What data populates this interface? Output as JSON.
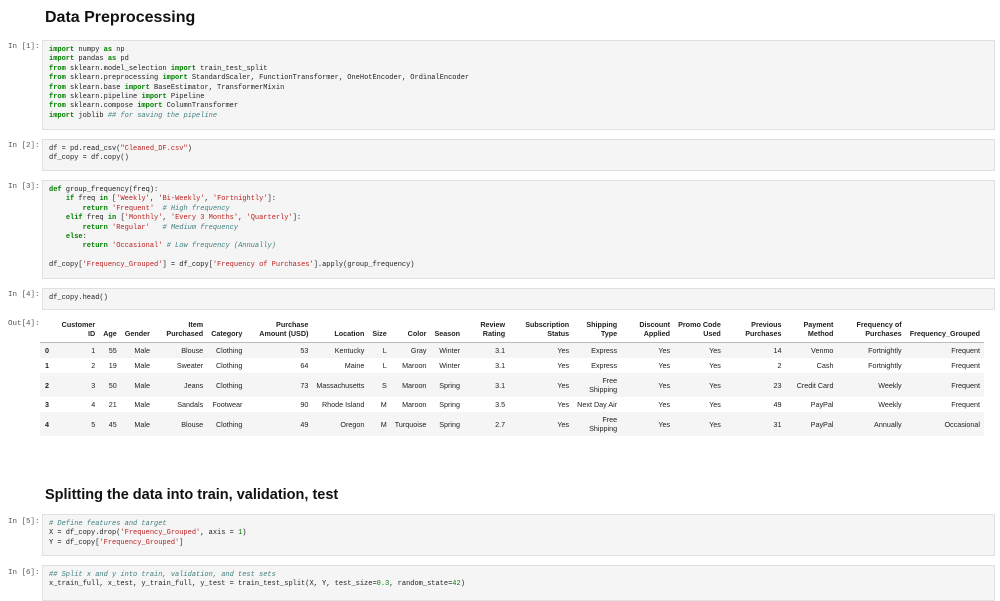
{
  "headings": {
    "preprocessing": "Data Preprocessing",
    "splitting": "Splitting the data into train, validation, test"
  },
  "cells": {
    "c1": {
      "prompt": "In [1]:",
      "lines": [
        [
          [
            "kw",
            "import"
          ],
          [
            "p",
            " numpy "
          ],
          [
            "kw",
            "as"
          ],
          [
            "p",
            " np"
          ]
        ],
        [
          [
            "kw",
            "import"
          ],
          [
            "p",
            " pandas "
          ],
          [
            "kw",
            "as"
          ],
          [
            "p",
            " pd"
          ]
        ],
        [
          [
            "kw",
            "from"
          ],
          [
            "p",
            " sklearn.model_selection "
          ],
          [
            "kw",
            "import"
          ],
          [
            "p",
            " train_test_split"
          ]
        ],
        [
          [
            "kw",
            "from"
          ],
          [
            "p",
            " sklearn.preprocessing "
          ],
          [
            "kw",
            "import"
          ],
          [
            "p",
            " StandardScaler, FunctionTransformer, OneHotEncoder, OrdinalEncoder"
          ]
        ],
        [
          [
            "kw",
            "from"
          ],
          [
            "p",
            " sklearn.base "
          ],
          [
            "kw",
            "import"
          ],
          [
            "p",
            " BaseEstimator, TransformerMixin"
          ]
        ],
        [
          [
            "kw",
            "from"
          ],
          [
            "p",
            " sklearn.pipeline "
          ],
          [
            "kw",
            "import"
          ],
          [
            "p",
            " Pipeline"
          ]
        ],
        [
          [
            "kw",
            "from"
          ],
          [
            "p",
            " sklearn.compose "
          ],
          [
            "kw",
            "import"
          ],
          [
            "p",
            " ColumnTransformer"
          ]
        ],
        [
          [
            "kw",
            "import"
          ],
          [
            "p",
            " joblib "
          ],
          [
            "cm",
            "## for saving the pipeline"
          ]
        ]
      ]
    },
    "c2": {
      "prompt": "In [2]:",
      "lines": [
        [
          [
            "p",
            "df = pd.read_csv("
          ],
          [
            "st",
            "\"Cleaned_DF.csv\""
          ],
          [
            "p",
            ")"
          ]
        ],
        [
          [
            "p",
            "df_copy = df.copy()"
          ]
        ]
      ]
    },
    "c3": {
      "prompt": "In [3]:",
      "lines": [
        [
          [
            "kw",
            "def"
          ],
          [
            "p",
            " group_frequency(freq):"
          ]
        ],
        [
          [
            "p",
            "    "
          ],
          [
            "kw",
            "if"
          ],
          [
            "p",
            " freq "
          ],
          [
            "kw",
            "in"
          ],
          [
            "p",
            " ["
          ],
          [
            "st",
            "'Weekly'"
          ],
          [
            "p",
            ", "
          ],
          [
            "st",
            "'Bi-Weekly'"
          ],
          [
            "p",
            ", "
          ],
          [
            "st",
            "'Fortnightly'"
          ],
          [
            "p",
            "]:"
          ]
        ],
        [
          [
            "p",
            "        "
          ],
          [
            "kw",
            "return"
          ],
          [
            "p",
            " "
          ],
          [
            "st",
            "'Frequent'"
          ],
          [
            "p",
            "  "
          ],
          [
            "cm",
            "# High frequency"
          ]
        ],
        [
          [
            "p",
            "    "
          ],
          [
            "kw",
            "elif"
          ],
          [
            "p",
            " freq "
          ],
          [
            "kw",
            "in"
          ],
          [
            "p",
            " ["
          ],
          [
            "st",
            "'Monthly'"
          ],
          [
            "p",
            ", "
          ],
          [
            "st",
            "'Every 3 Months'"
          ],
          [
            "p",
            ", "
          ],
          [
            "st",
            "'Quarterly'"
          ],
          [
            "p",
            "]:"
          ]
        ],
        [
          [
            "p",
            "        "
          ],
          [
            "kw",
            "return"
          ],
          [
            "p",
            " "
          ],
          [
            "st",
            "'Regular'"
          ],
          [
            "p",
            "   "
          ],
          [
            "cm",
            "# Medium frequency"
          ]
        ],
        [
          [
            "p",
            "    "
          ],
          [
            "kw",
            "else"
          ],
          [
            "p",
            ":"
          ]
        ],
        [
          [
            "p",
            "        "
          ],
          [
            "kw",
            "return"
          ],
          [
            "p",
            " "
          ],
          [
            "st",
            "'Occasional'"
          ],
          [
            "p",
            " "
          ],
          [
            "cm",
            "# Low frequency (Annually)"
          ]
        ],
        [
          [
            "p",
            " "
          ]
        ],
        [
          [
            "p",
            "df_copy["
          ],
          [
            "st",
            "'Frequency_Grouped'"
          ],
          [
            "p",
            "] = df_copy["
          ],
          [
            "st",
            "'Frequency of Purchases'"
          ],
          [
            "p",
            "].apply(group_frequency)"
          ]
        ]
      ]
    },
    "c4": {
      "prompt": "In [4]:",
      "lines": [
        [
          [
            "p",
            "df_copy.head()"
          ]
        ]
      ]
    },
    "c5": {
      "prompt": "In [5]:",
      "lines": [
        [
          [
            "cm",
            "# Define features and target"
          ]
        ],
        [
          [
            "p",
            "X = df_copy.drop("
          ],
          [
            "st",
            "'Frequency_Grouped'"
          ],
          [
            "p",
            ", axis = "
          ],
          [
            "nm",
            "1"
          ],
          [
            "p",
            ")"
          ]
        ],
        [
          [
            "p",
            "Y = df_copy["
          ],
          [
            "st",
            "'Frequency_Grouped'"
          ],
          [
            "p",
            "]"
          ]
        ]
      ]
    },
    "c6": {
      "prompt": "In [6]:",
      "lines": [
        [
          [
            "cm",
            "## Split x and y into train, validation, and test sets"
          ]
        ],
        [
          [
            "p",
            "x_train_full, x_test, y_train_full, y_test = train_test_split(X, Y, test_size="
          ],
          [
            "nm",
            "0.3"
          ],
          [
            "p",
            ", random_state="
          ],
          [
            "nm",
            "42"
          ],
          [
            "p",
            ")"
          ]
        ]
      ]
    }
  },
  "output": {
    "prompt": "Out[4]:",
    "columns": [
      "",
      "Customer ID",
      "Age",
      "Gender",
      "Item Purchased",
      "Category",
      "Purchase Amount (USD)",
      "Location",
      "Size",
      "Color",
      "Season",
      "Review Rating",
      "Subscription Status",
      "Shipping Type",
      "Discount Applied",
      "Promo Code Used",
      "Previous Purchases",
      "Payment Method",
      "Frequency of Purchases",
      "Frequency_Grouped"
    ],
    "rows": [
      [
        "0",
        "1",
        "55",
        "Male",
        "Blouse",
        "Clothing",
        "53",
        "Kentucky",
        "L",
        "Gray",
        "Winter",
        "3.1",
        "Yes",
        "Express",
        "Yes",
        "Yes",
        "14",
        "Venmo",
        "Fortnightly",
        "Frequent"
      ],
      [
        "1",
        "2",
        "19",
        "Male",
        "Sweater",
        "Clothing",
        "64",
        "Maine",
        "L",
        "Maroon",
        "Winter",
        "3.1",
        "Yes",
        "Express",
        "Yes",
        "Yes",
        "2",
        "Cash",
        "Fortnightly",
        "Frequent"
      ],
      [
        "2",
        "3",
        "50",
        "Male",
        "Jeans",
        "Clothing",
        "73",
        "Massachusetts",
        "S",
        "Maroon",
        "Spring",
        "3.1",
        "Yes",
        "Free Shipping",
        "Yes",
        "Yes",
        "23",
        "Credit Card",
        "Weekly",
        "Frequent"
      ],
      [
        "3",
        "4",
        "21",
        "Male",
        "Sandals",
        "Footwear",
        "90",
        "Rhode Island",
        "M",
        "Maroon",
        "Spring",
        "3.5",
        "Yes",
        "Next Day Air",
        "Yes",
        "Yes",
        "49",
        "PayPal",
        "Weekly",
        "Frequent"
      ],
      [
        "4",
        "5",
        "45",
        "Male",
        "Blouse",
        "Clothing",
        "49",
        "Oregon",
        "M",
        "Turquoise",
        "Spring",
        "2.7",
        "Yes",
        "Free Shipping",
        "Yes",
        "Yes",
        "31",
        "PayPal",
        "Annually",
        "Occasional"
      ]
    ]
  }
}
